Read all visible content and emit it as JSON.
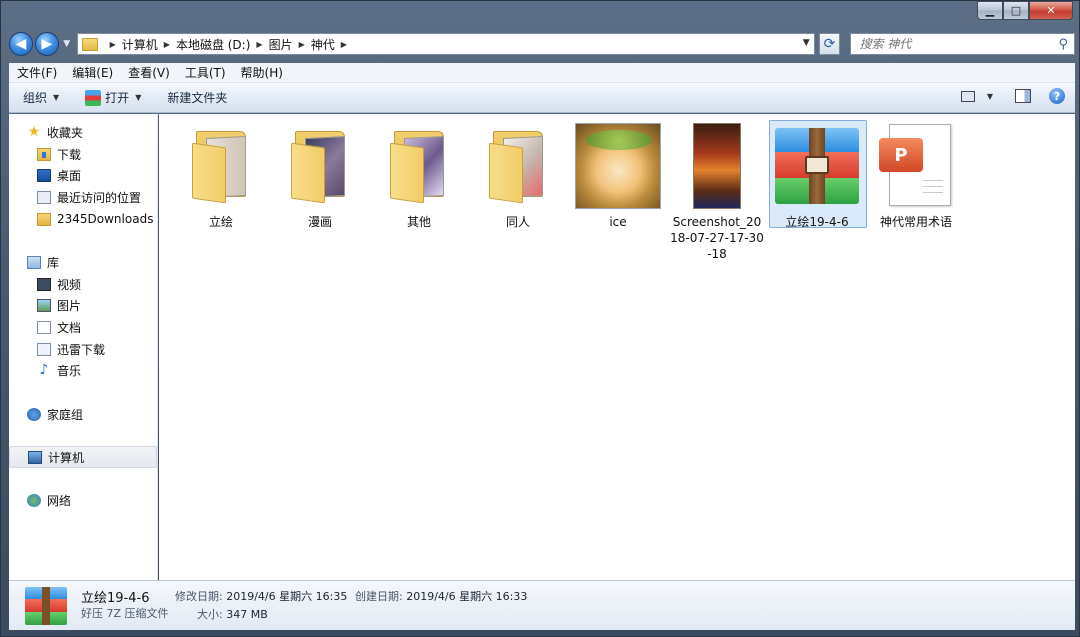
{
  "window": {
    "minimize": "▁",
    "maximize": "□",
    "close": "✕"
  },
  "address": {
    "crumbs": [
      "计算机",
      "本地磁盘 (D:)",
      "图片",
      "神代"
    ],
    "search_placeholder": "搜索 神代"
  },
  "menu": [
    "文件(F)",
    "编辑(E)",
    "查看(V)",
    "工具(T)",
    "帮助(H)"
  ],
  "toolbar": {
    "organize": "组织",
    "open": "打开",
    "new_folder": "新建文件夹",
    "help": "?"
  },
  "nav": {
    "favorites": {
      "label": "收藏夹",
      "items": [
        "下载",
        "桌面",
        "最近访问的位置",
        "2345Downloads"
      ]
    },
    "libraries": {
      "label": "库",
      "items": [
        "视频",
        "图片",
        "文档",
        "迅雷下载",
        "音乐"
      ]
    },
    "homegroup": "家庭组",
    "computer": "计算机",
    "network": "网络"
  },
  "files": [
    {
      "name": "立绘",
      "type": "folder"
    },
    {
      "name": "漫画",
      "type": "folder"
    },
    {
      "name": "其他",
      "type": "folder"
    },
    {
      "name": "同人",
      "type": "folder"
    },
    {
      "name": "ice",
      "type": "image"
    },
    {
      "name": "Screenshot_2018-07-27-17-30-18",
      "type": "image"
    },
    {
      "name": "立绘19-4-6",
      "type": "archive",
      "selected": true
    },
    {
      "name": "神代常用术语",
      "type": "ppt"
    }
  ],
  "details": {
    "name": "立绘19-4-6",
    "type": "好压 7Z 压缩文件",
    "modified_label": "修改日期:",
    "modified": "2019/4/6 星期六 16:35",
    "created_label": "创建日期:",
    "created": "2019/4/6 星期六 16:33",
    "size_label": "大小:",
    "size": "347 MB"
  },
  "colors": {
    "selection_bg": "#d9ebfb",
    "selection_border": "#84acdd",
    "frame": "#4a5b70"
  }
}
